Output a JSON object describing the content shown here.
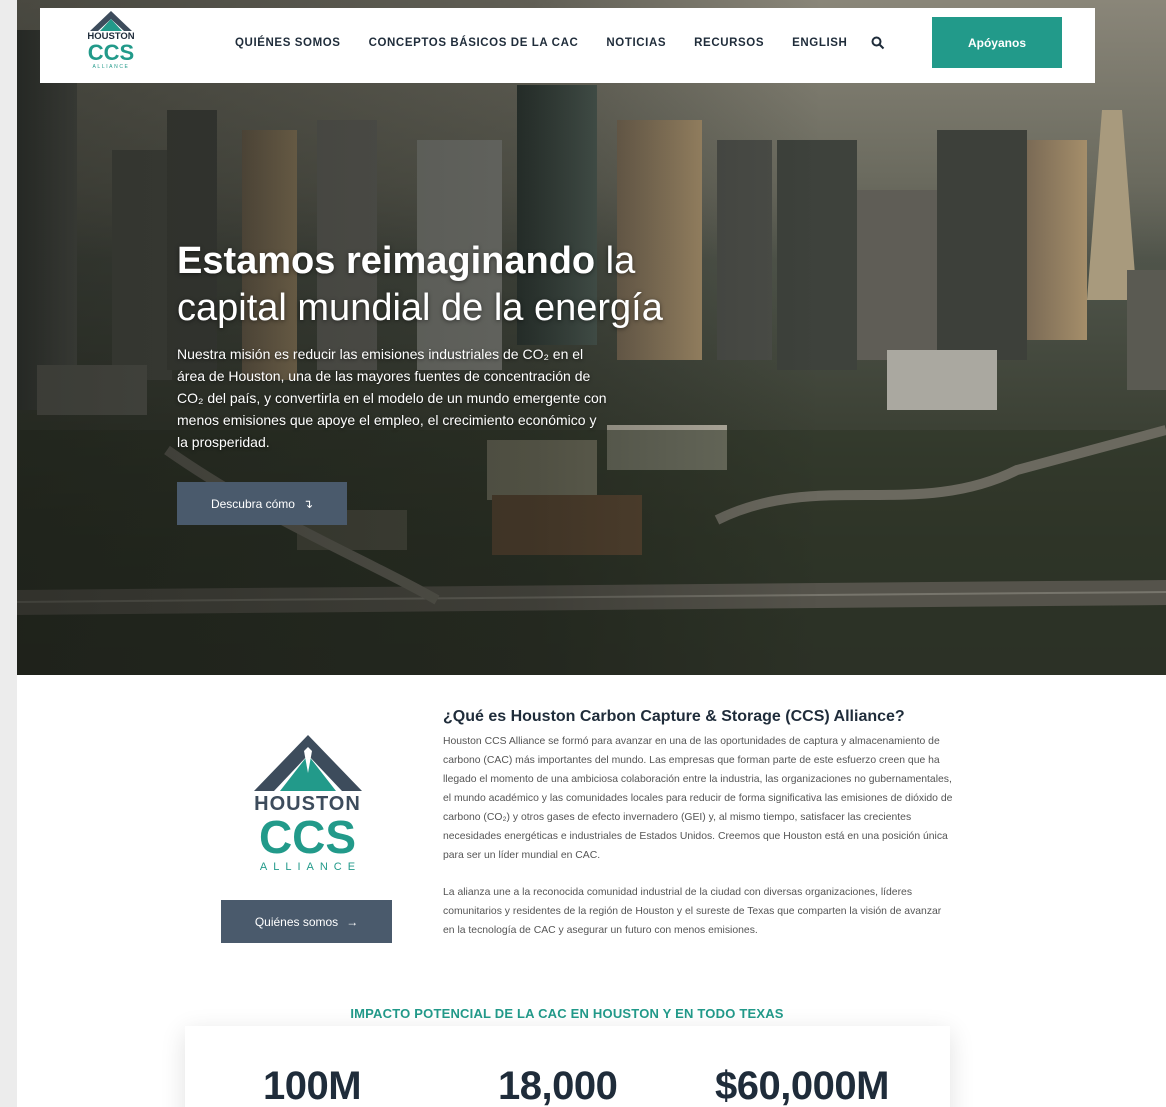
{
  "nav": {
    "logo_top": "HOUSTON",
    "logo_mid": "CCS",
    "logo_bottom": "ALLIANCE",
    "items": [
      {
        "label": "QUIÉNES SOMOS"
      },
      {
        "label": "CONCEPTOS BÁSICOS DE LA CAC"
      },
      {
        "label": "NOTICIAS"
      },
      {
        "label": "RECURSOS"
      },
      {
        "label": "ENGLISH"
      }
    ],
    "support_label": "Apóyanos"
  },
  "hero": {
    "headline_bold": "Estamos reimaginando",
    "headline_rest": " la capital mundial de la energía",
    "mission": "Nuestra misión es reducir las emisiones industriales de CO₂ en el área de Houston, una de las mayores fuentes de concentración de CO₂ del país, y convertirla en el modelo de un mundo emergente con menos emisiones que apoye el empleo, el crecimiento económico y la prosperidad.",
    "cta_label": "Descubra cómo",
    "cta_icon": "↴"
  },
  "about": {
    "logo_top": "HOUSTON",
    "logo_mid": "CCS",
    "logo_bottom": "ALLIANCE",
    "title": "¿Qué es Houston Carbon Capture & Storage (CCS) Alliance?",
    "para1": "Houston CCS Alliance se formó para avanzar en una de las oportunidades de captura y almacenamiento de carbono (CAC) más importantes del mundo. Las empresas que forman parte de este esfuerzo creen que ha llegado el momento de una ambiciosa colaboración entre la industria, las organizaciones no gubernamentales, el mundo académico y las comunidades locales para reducir de forma significativa las emisiones de dióxido de carbono (CO₂) y otros gases de efecto invernadero (GEI) y, al mismo tiempo, satisfacer las crecientes necesidades energéticas e industriales de Estados Unidos. Creemos que Houston está en una posición única para ser un líder mundial en CAC.",
    "para2": "La alianza une a la reconocida comunidad industrial de la ciudad con diversas organizaciones, líderes comunitarios y residentes de la región de Houston y el sureste de Texas que comparten la visión de avanzar en la tecnología de CAC y asegurar un futuro con menos emisiones.",
    "button_label": "Quiénes somos",
    "button_icon": "→"
  },
  "impact": {
    "title": "IMPACTO POTENCIAL DE LA CAC EN HOUSTON Y EN TODO TEXAS",
    "stats": [
      {
        "value": "100M"
      },
      {
        "value": "18,000"
      },
      {
        "value": "$60,000M"
      }
    ]
  },
  "colors": {
    "accent": "#229a8a",
    "navy": "#1f2c3a",
    "button": "#4a5a6c"
  }
}
